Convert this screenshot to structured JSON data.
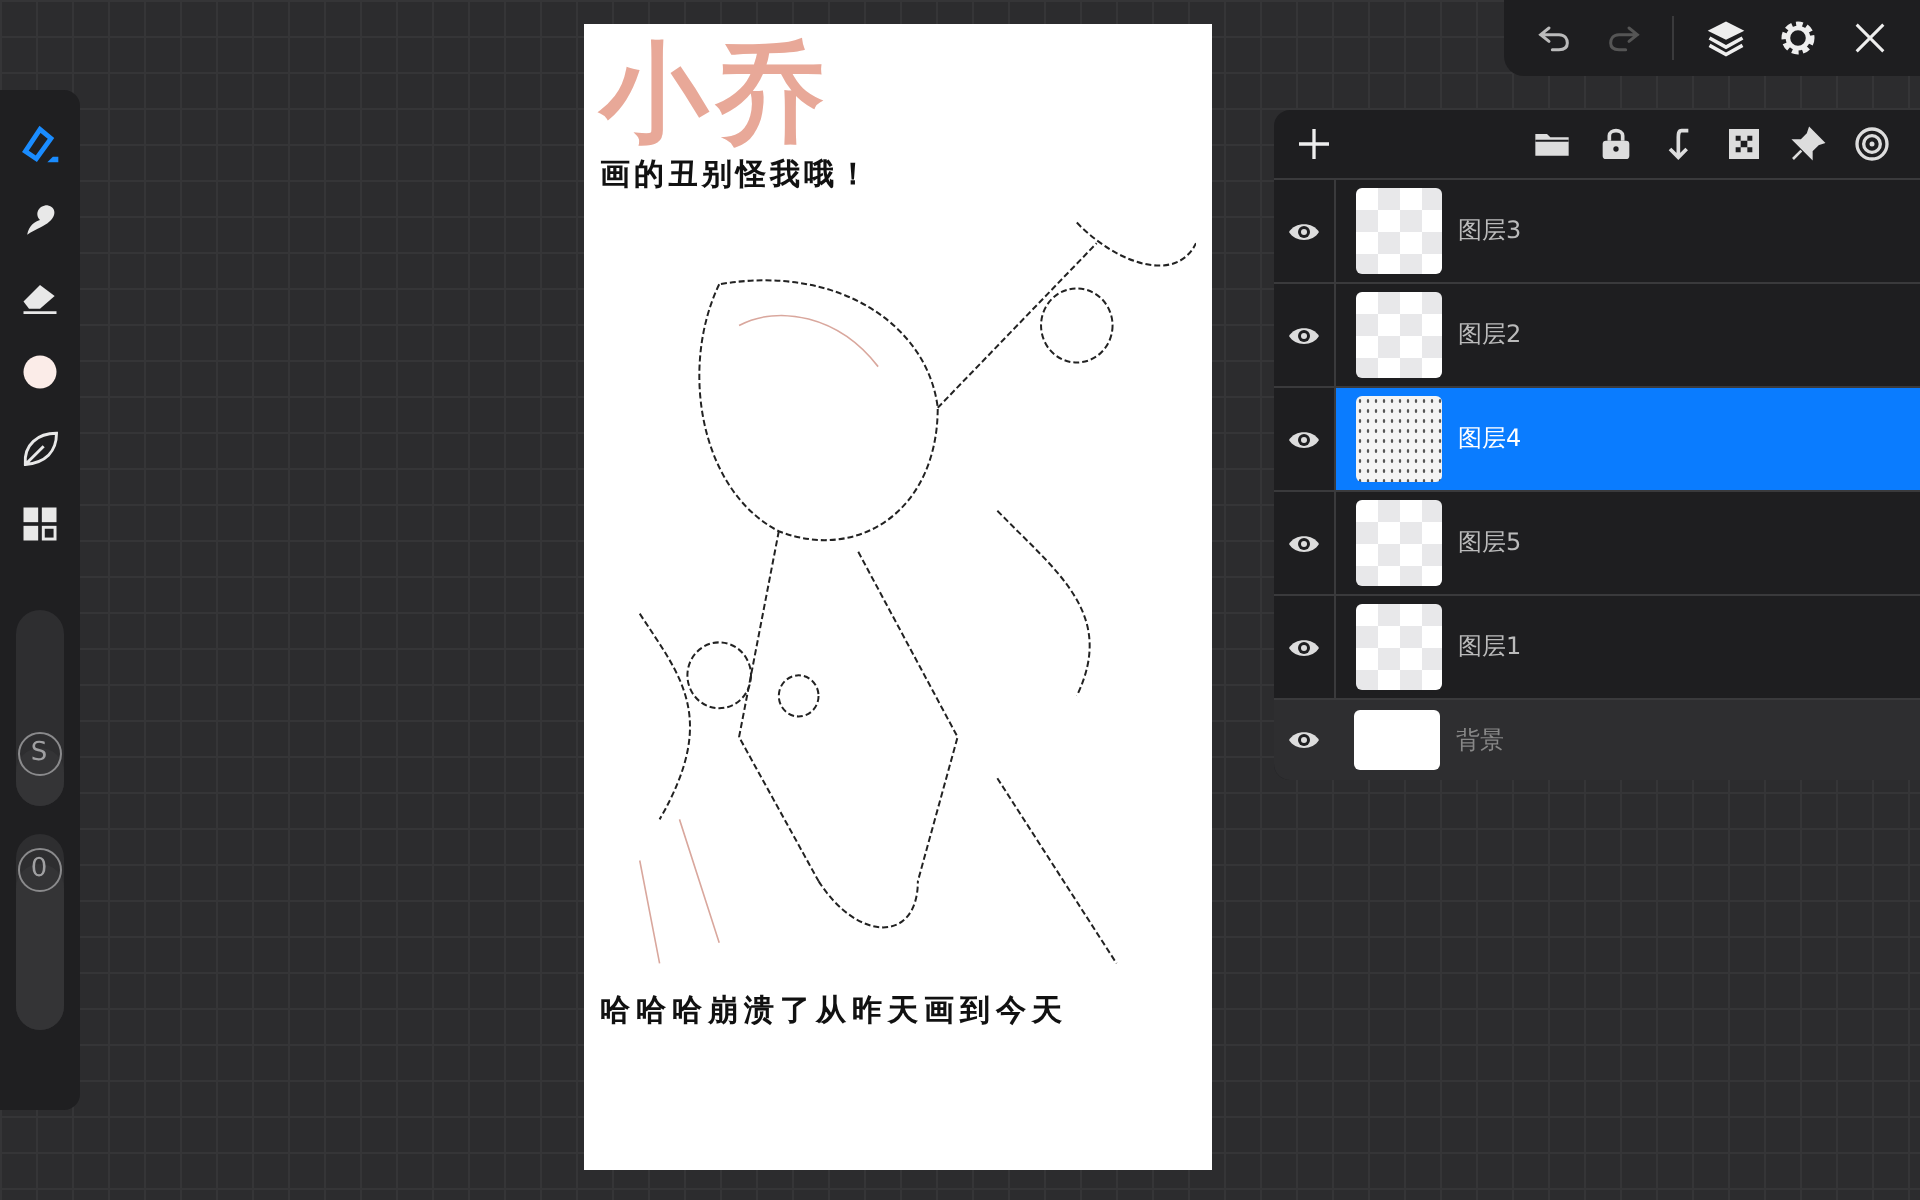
{
  "tools": [
    {
      "kind": "brush",
      "selected": true
    },
    {
      "kind": "smudge",
      "selected": false
    },
    {
      "kind": "eraser",
      "selected": false
    },
    {
      "kind": "color",
      "selected": false
    },
    {
      "kind": "leaf",
      "selected": false
    },
    {
      "kind": "grid",
      "selected": false
    }
  ],
  "sliders": [
    {
      "label": "S",
      "level": 0.3
    },
    {
      "label": "0",
      "level": 0.85
    }
  ],
  "canvas": {
    "title": "小乔",
    "caption": "画的丑别怪我哦！",
    "footer": "哈哈哈崩溃了从昨天画到今天"
  },
  "layers": [
    {
      "name": "图层3",
      "kind": "transparent",
      "visible": true,
      "selected": false
    },
    {
      "name": "图层2",
      "kind": "transparent",
      "visible": true,
      "selected": false
    },
    {
      "name": "图层4",
      "kind": "sketch",
      "visible": true,
      "selected": true
    },
    {
      "name": "图层5",
      "kind": "transparent",
      "visible": true,
      "selected": false
    },
    {
      "name": "图层1",
      "kind": "transparent",
      "visible": true,
      "selected": false
    },
    {
      "name": "背景",
      "kind": "white",
      "visible": true,
      "selected": false
    }
  ]
}
